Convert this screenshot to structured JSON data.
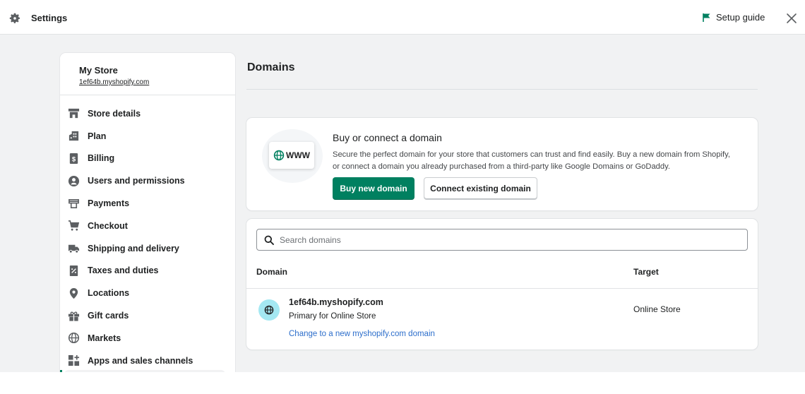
{
  "topbar": {
    "title": "Settings",
    "setup_guide": "Setup guide"
  },
  "store": {
    "name": "My Store",
    "url": "1ef64b.myshopify.com"
  },
  "nav": {
    "items": [
      {
        "label": "Store details",
        "icon": "store-icon"
      },
      {
        "label": "Plan",
        "icon": "plan-icon"
      },
      {
        "label": "Billing",
        "icon": "billing-icon"
      },
      {
        "label": "Users and permissions",
        "icon": "user-icon"
      },
      {
        "label": "Payments",
        "icon": "payments-icon"
      },
      {
        "label": "Checkout",
        "icon": "cart-icon"
      },
      {
        "label": "Shipping and delivery",
        "icon": "truck-icon"
      },
      {
        "label": "Taxes and duties",
        "icon": "tax-icon"
      },
      {
        "label": "Locations",
        "icon": "location-pin-icon"
      },
      {
        "label": "Gift cards",
        "icon": "gift-icon"
      },
      {
        "label": "Markets",
        "icon": "globe-icon"
      },
      {
        "label": "Apps and sales channels",
        "icon": "apps-icon"
      }
    ]
  },
  "page": {
    "title": "Domains"
  },
  "promo": {
    "badge": "WWW",
    "title": "Buy or connect a domain",
    "description": "Secure the perfect domain for your store that customers can trust and find easily. Buy a new domain from Shopify, or connect a domain you already purchased from a third-party like Google Domains or GoDaddy.",
    "buy_button": "Buy new domain",
    "connect_button": "Connect existing domain"
  },
  "domains": {
    "search_placeholder": "Search domains",
    "columns": [
      "Domain",
      "Target"
    ],
    "rows": [
      {
        "domain": "1ef64b.myshopify.com",
        "subtitle": "Primary for Online Store",
        "link": "Change to a new myshopify.com domain",
        "target": "Online Store"
      }
    ]
  },
  "colors": {
    "primary": "#008060",
    "link": "#2c6ecb",
    "globe_badge": "#a4e8f2",
    "setup_flag": "#008060"
  }
}
